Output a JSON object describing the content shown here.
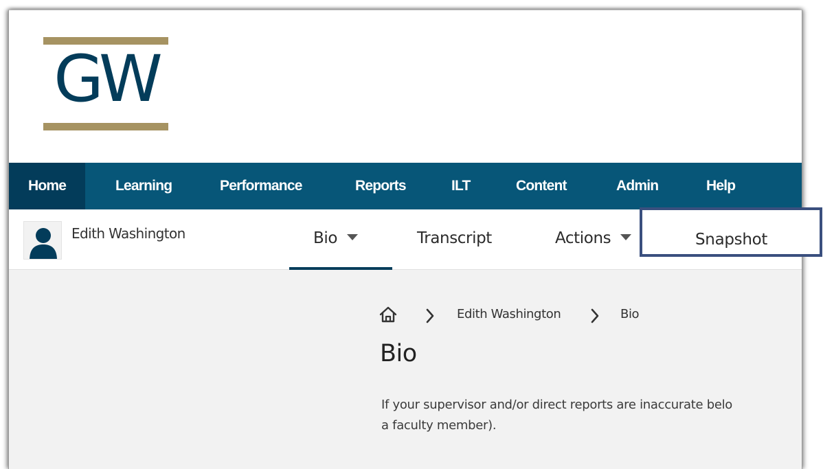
{
  "colors": {
    "brand_navy": "#033c5a",
    "brand_buff": "#a69362",
    "navbar_bg": "#075678",
    "navbar_active_bg": "#033c5a",
    "highlight_border": "#3a4f7e"
  },
  "logo": {
    "text": "GW"
  },
  "navbar": {
    "items": [
      {
        "label": "Home",
        "active": true
      },
      {
        "label": "Learning"
      },
      {
        "label": "Performance"
      },
      {
        "label": "Reports"
      },
      {
        "label": "ILT"
      },
      {
        "label": "Content"
      },
      {
        "label": "Admin"
      },
      {
        "label": "Help"
      }
    ]
  },
  "profile": {
    "avatar_icon": "user-silhouette-icon",
    "user_name": "Edith Washington",
    "tabs": [
      {
        "label": "Bio",
        "has_dropdown": true,
        "active": true
      },
      {
        "label": "Transcript"
      },
      {
        "label": "Actions",
        "has_dropdown": true
      },
      {
        "label": "Snapshot",
        "highlighted": true
      }
    ]
  },
  "breadcrumb": {
    "home_icon": "home-icon",
    "separator_icon": "chevron-right-icon",
    "items": [
      "Edith Washington",
      "Bio"
    ]
  },
  "page": {
    "title": "Bio",
    "intro_line1": "If your supervisor and/or direct reports are inaccurate belo",
    "intro_line2": "a faculty member)."
  }
}
